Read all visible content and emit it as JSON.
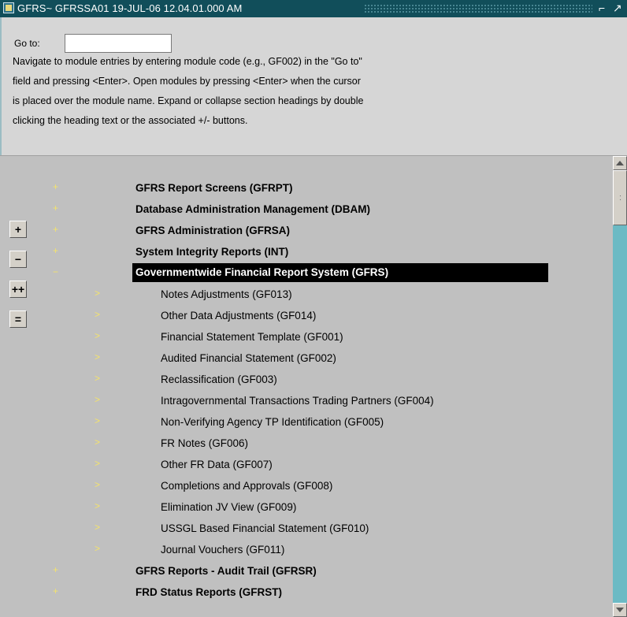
{
  "window": {
    "title": "GFRS~ GFRSSA01  19-JUL-06 12.04.01.000 AM",
    "minimize_glyph": "⌐",
    "maximize_glyph": "↗"
  },
  "goto": {
    "label": "Go to:",
    "value": ""
  },
  "help_lines": [
    "Navigate to module entries by entering module code (e.g., GF002) in the \"Go to\"",
    "field and pressing <Enter>.  Open modules by pressing <Enter> when the cursor",
    "is placed over the module name.  Expand or collapse section headings by double",
    "clicking the heading text or the associated +/- buttons."
  ],
  "side_buttons": [
    {
      "icon": "expand-icon",
      "glyph": "+"
    },
    {
      "icon": "collapse-icon",
      "glyph": "−"
    },
    {
      "icon": "expand-all-icon",
      "glyph": "++"
    },
    {
      "icon": "collapse-all-icon",
      "glyph": "="
    }
  ],
  "tree": {
    "sections_top": [
      {
        "label": "GFRS Report Screens  (GFRPT)",
        "marker": "+"
      },
      {
        "label": "Database Administration Management  (DBAM)",
        "marker": "+"
      },
      {
        "label": "GFRS Administration  (GFRSA)",
        "marker": "+"
      },
      {
        "label": "System Integrity Reports  (INT)",
        "marker": "+"
      },
      {
        "label": "Governmentwide Financial Report System  (GFRS)",
        "marker": "−",
        "selected": true
      }
    ],
    "children": [
      {
        "label": "Notes Adjustments  (GF013)",
        "marker": ">"
      },
      {
        "label": "Other Data Adjustments  (GF014)",
        "marker": ">"
      },
      {
        "label": "Financial Statement Template  (GF001)",
        "marker": ">"
      },
      {
        "label": "Audited Financial Statement  (GF002)",
        "marker": ">"
      },
      {
        "label": "Reclassification  (GF003)",
        "marker": ">"
      },
      {
        "label": "Intragovernmental Transactions Trading Partners  (GF004)",
        "marker": ">"
      },
      {
        "label": "Non-Verifying Agency TP Identification  (GF005)",
        "marker": ">"
      },
      {
        "label": "FR Notes  (GF006)",
        "marker": ">"
      },
      {
        "label": "Other FR Data  (GF007)",
        "marker": ">"
      },
      {
        "label": "Completions and Approvals  (GF008)",
        "marker": ">"
      },
      {
        "label": "Elimination JV View  (GF009)",
        "marker": ">"
      },
      {
        "label": "USSGL Based Financial Statement  (GF010)",
        "marker": ">"
      },
      {
        "label": "Journal Vouchers  (GF011)",
        "marker": ">"
      }
    ],
    "sections_bottom": [
      {
        "label": "GFRS Reports - Audit Trail  (GFRSR)",
        "marker": "+"
      },
      {
        "label": "FRD Status Reports  (GFRST)",
        "marker": "+"
      }
    ]
  },
  "colors": {
    "titlebar": "#114e5a",
    "marker": "#f4e36b",
    "selected_bg": "#000000",
    "scrollbar": "#6cbac4"
  }
}
